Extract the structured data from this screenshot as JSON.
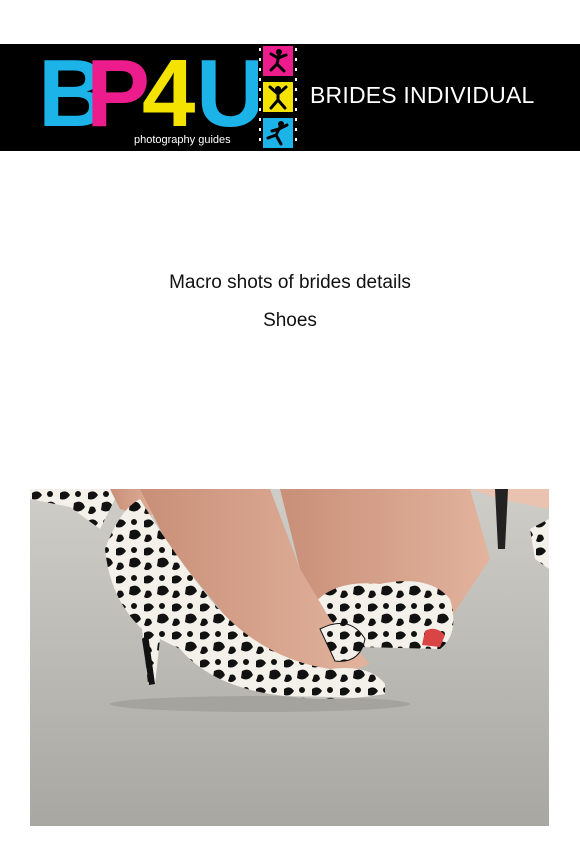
{
  "header": {
    "logo": {
      "letters": [
        "B",
        "P",
        "4",
        "U"
      ],
      "letter_colors": [
        "#1bb3e8",
        "#ec1c8c",
        "#f4e300",
        "#1bb3e8"
      ],
      "tagline": "photography guides"
    },
    "film_strip": {
      "frame_colors": [
        "#ec1c8c",
        "#f4e300",
        "#1bb3e8"
      ],
      "frame_icons": [
        "jumping-person-icon",
        "jumping-person-icon",
        "jumping-person-icon"
      ]
    },
    "title": "BRIDES INDIVIDUAL",
    "background": "#000000",
    "title_color": "#ffffff"
  },
  "content": {
    "subtitle_line1": "Macro shots of brides details",
    "subtitle_line2": "Shoes"
  },
  "photo": {
    "subject": "black-and-white floral peep-toe high heel shoes on concrete",
    "icon": "bride-shoes-photo"
  }
}
